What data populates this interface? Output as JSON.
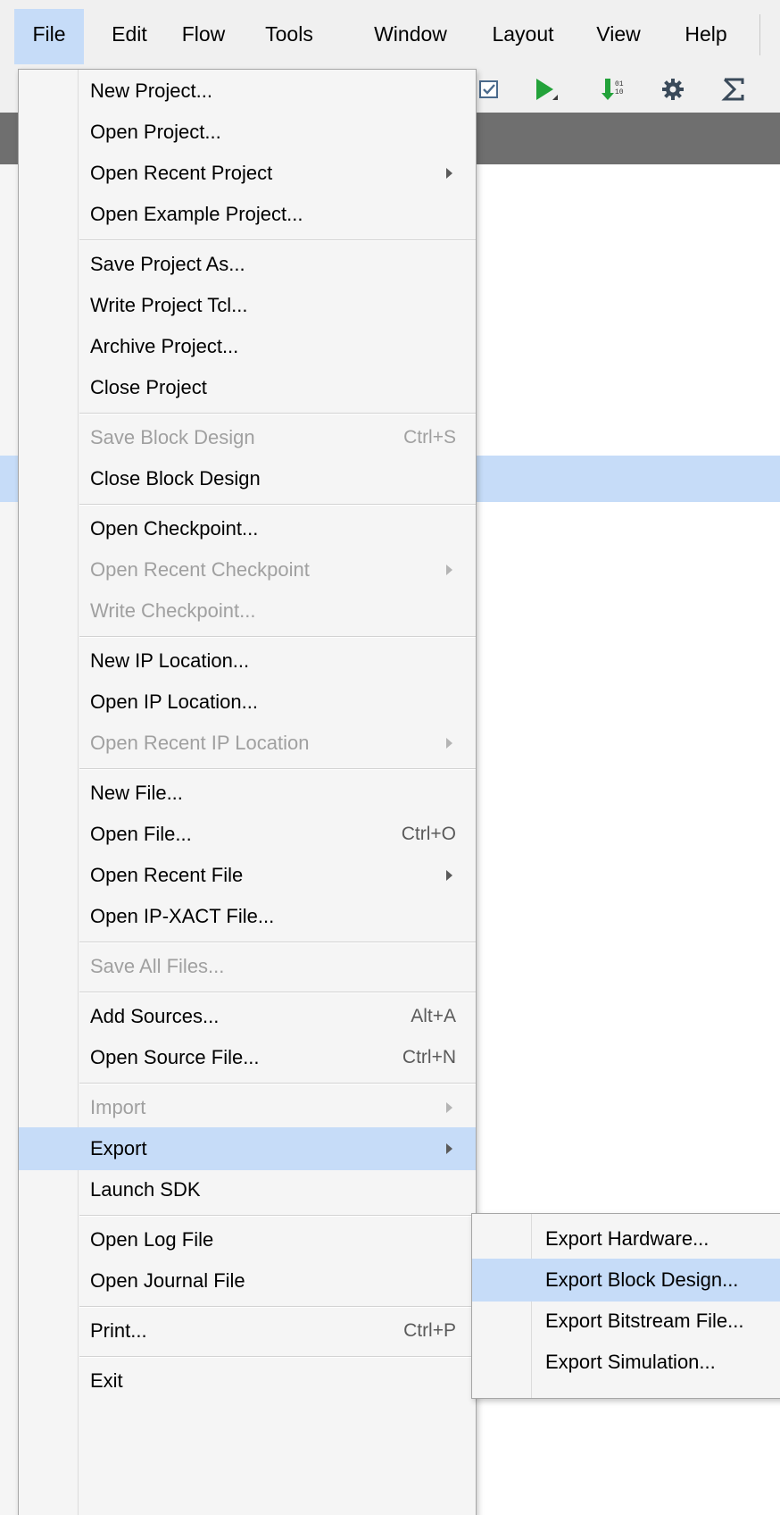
{
  "menubar": {
    "items": [
      {
        "label": "File",
        "active": true
      },
      {
        "label": "Edit"
      },
      {
        "label": "Flow"
      },
      {
        "label": "Tools"
      },
      {
        "label": "Window"
      },
      {
        "label": "Layout"
      },
      {
        "label": "View"
      },
      {
        "label": "Help"
      }
    ]
  },
  "toolbar": {
    "icons": [
      "checkbox-icon",
      "run-icon",
      "bitstream-icon",
      "settings-icon",
      "sigma-icon"
    ]
  },
  "file_menu": {
    "items": [
      {
        "label": "New Project...",
        "shortcut": "",
        "submenu": false,
        "disabled": false
      },
      {
        "label": "Open Project...",
        "shortcut": "",
        "submenu": false,
        "disabled": false
      },
      {
        "label": "Open Recent Project",
        "shortcut": "",
        "submenu": true,
        "disabled": false
      },
      {
        "label": "Open Example Project...",
        "shortcut": "",
        "submenu": false,
        "disabled": false
      },
      {
        "label": "Save Project As...",
        "shortcut": "",
        "submenu": false,
        "disabled": false
      },
      {
        "label": "Write Project Tcl...",
        "shortcut": "",
        "submenu": false,
        "disabled": false
      },
      {
        "label": "Archive Project...",
        "shortcut": "",
        "submenu": false,
        "disabled": false
      },
      {
        "label": "Close Project",
        "shortcut": "",
        "submenu": false,
        "disabled": false
      },
      {
        "label": "Save Block Design",
        "shortcut": "Ctrl+S",
        "submenu": false,
        "disabled": true
      },
      {
        "label": "Close Block Design",
        "shortcut": "",
        "submenu": false,
        "disabled": false
      },
      {
        "label": "Open Checkpoint...",
        "shortcut": "",
        "submenu": false,
        "disabled": false
      },
      {
        "label": "Open Recent Checkpoint",
        "shortcut": "",
        "submenu": true,
        "disabled": true
      },
      {
        "label": "Write Checkpoint...",
        "shortcut": "",
        "submenu": false,
        "disabled": true
      },
      {
        "label": "New IP Location...",
        "shortcut": "",
        "submenu": false,
        "disabled": false
      },
      {
        "label": "Open IP Location...",
        "shortcut": "",
        "submenu": false,
        "disabled": false
      },
      {
        "label": "Open Recent IP Location",
        "shortcut": "",
        "submenu": true,
        "disabled": true
      },
      {
        "label": "New File...",
        "shortcut": "",
        "submenu": false,
        "disabled": false
      },
      {
        "label": "Open File...",
        "shortcut": "Ctrl+O",
        "submenu": false,
        "disabled": false
      },
      {
        "label": "Open Recent File",
        "shortcut": "",
        "submenu": true,
        "disabled": false
      },
      {
        "label": "Open IP-XACT File...",
        "shortcut": "",
        "submenu": false,
        "disabled": false
      },
      {
        "label": "Save All Files...",
        "shortcut": "",
        "submenu": false,
        "disabled": true
      },
      {
        "label": "Add Sources...",
        "shortcut": "Alt+A",
        "submenu": false,
        "disabled": false
      },
      {
        "label": "Open Source File...",
        "shortcut": "Ctrl+N",
        "submenu": false,
        "disabled": false
      },
      {
        "label": "Import",
        "shortcut": "",
        "submenu": true,
        "disabled": true
      },
      {
        "label": "Export",
        "shortcut": "",
        "submenu": true,
        "disabled": false,
        "selected": true
      },
      {
        "label": "Launch SDK",
        "shortcut": "",
        "submenu": false,
        "disabled": false
      },
      {
        "label": "Open Log File",
        "shortcut": "",
        "submenu": false,
        "disabled": false
      },
      {
        "label": "Open Journal File",
        "shortcut": "",
        "submenu": false,
        "disabled": false
      },
      {
        "label": "Print...",
        "shortcut": "Ctrl+P",
        "submenu": false,
        "disabled": false
      },
      {
        "label": "Exit",
        "shortcut": "",
        "submenu": false,
        "disabled": false
      }
    ]
  },
  "export_menu": {
    "items": [
      {
        "label": "Export Hardware...",
        "selected": false
      },
      {
        "label": "Export Block Design...",
        "selected": true
      },
      {
        "label": "Export Bitstream File...",
        "selected": false
      },
      {
        "label": "Export Simulation...",
        "selected": false
      }
    ]
  },
  "colors": {
    "selection": "#c6dcf8",
    "menu_bg": "#f5f5f5",
    "disabled_text": "#a0a0a0",
    "dark_band": "#6f6f6f",
    "run_green": "#23a23a"
  }
}
